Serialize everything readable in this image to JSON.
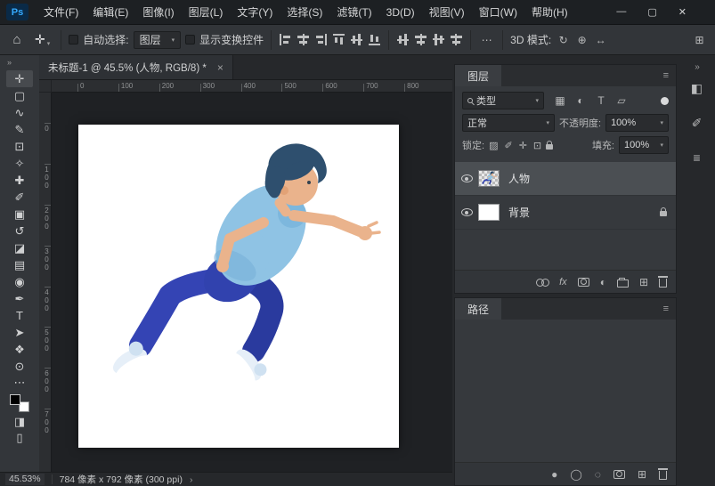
{
  "app": {
    "accent": "#31a8ff",
    "bg_dark": "#1d2023",
    "bg_panel": "#36393d"
  },
  "titlebar": {
    "logo": "Ps",
    "menus": [
      {
        "name": "menu-file",
        "label": "文件(F)"
      },
      {
        "name": "menu-edit",
        "label": "编辑(E)"
      },
      {
        "name": "menu-image",
        "label": "图像(I)"
      },
      {
        "name": "menu-layer",
        "label": "图层(L)"
      },
      {
        "name": "menu-type",
        "label": "文字(Y)"
      },
      {
        "name": "menu-select",
        "label": "选择(S)"
      },
      {
        "name": "menu-filter",
        "label": "滤镜(T)"
      },
      {
        "name": "menu-3d",
        "label": "3D(D)"
      },
      {
        "name": "menu-view",
        "label": "视图(V)"
      },
      {
        "name": "menu-window",
        "label": "窗口(W)"
      },
      {
        "name": "menu-help",
        "label": "帮助(H)"
      }
    ],
    "controls": [
      {
        "name": "minimize-button",
        "glyph": "—"
      },
      {
        "name": "maximize-button",
        "glyph": "▢"
      },
      {
        "name": "close-button",
        "glyph": "✕"
      }
    ]
  },
  "options_bar": {
    "home_icon": "⌂",
    "tool_glyph": "✛",
    "tool_chevron": "▾",
    "auto_select_label": "自动选择:",
    "auto_select_value": "图层",
    "chevron": "▾",
    "show_transform_label": "显示变换控件",
    "more_icon": "⋯",
    "mode_label": "3D 模式:",
    "mode_icons": [
      {
        "name": "3d-rotate-icon",
        "glyph": "↻"
      },
      {
        "name": "3d-pan-icon",
        "glyph": "⊕"
      },
      {
        "name": "3d-scale-icon",
        "glyph": "↔"
      }
    ],
    "workspace_icon": "⊞"
  },
  "document": {
    "tab_title": "未标题-1 @ 45.5% (人物, RGB/8) *",
    "close_icon": "×"
  },
  "toolbar": {
    "expand_icon": "»",
    "tools": [
      {
        "name": "move-tool",
        "glyph": "✛",
        "selected": true
      },
      {
        "name": "rectangular-marquee-tool",
        "glyph": "▢"
      },
      {
        "name": "lasso-tool",
        "glyph": "∿"
      },
      {
        "name": "quick-selection-tool",
        "glyph": "✎"
      },
      {
        "name": "crop-tool",
        "glyph": "⊡"
      },
      {
        "name": "eyedropper-tool",
        "glyph": "✧"
      },
      {
        "name": "spot-healing-tool",
        "glyph": "✚"
      },
      {
        "name": "brush-tool",
        "glyph": "✐"
      },
      {
        "name": "clone-stamp-tool",
        "glyph": "▣"
      },
      {
        "name": "history-brush-tool",
        "glyph": "↺"
      },
      {
        "name": "eraser-tool",
        "glyph": "◪"
      },
      {
        "name": "gradient-tool",
        "glyph": "▤"
      },
      {
        "name": "blur-tool",
        "glyph": "◉"
      },
      {
        "name": "pen-tool",
        "glyph": "✒"
      },
      {
        "name": "type-tool",
        "glyph": "T"
      },
      {
        "name": "path-selection-tool",
        "glyph": "➤"
      },
      {
        "name": "hand-tool",
        "glyph": "❖"
      },
      {
        "name": "zoom-tool",
        "glyph": "⊙"
      }
    ],
    "more_icon": "⋯",
    "foreground_color": "#000000",
    "background_color": "#ffffff",
    "quick_mask_icon": "◨",
    "screen_mode_icon": "▯"
  },
  "rulers": {
    "horizontal": [
      "0",
      "100",
      "200",
      "300",
      "400",
      "500",
      "600",
      "700",
      "800"
    ],
    "vertical": [
      "0",
      "100",
      "200",
      "300",
      "400",
      "500",
      "600",
      "700"
    ]
  },
  "layers_panel": {
    "tab": "图层",
    "menu_icon": "≡",
    "filter": {
      "search_label": "类型",
      "chevron": "▾",
      "icons": [
        {
          "name": "filter-pixel-icon",
          "glyph": "▦"
        },
        {
          "name": "filter-adjustment-icon",
          "glyph": "◐"
        },
        {
          "name": "filter-type-icon",
          "glyph": "T"
        },
        {
          "name": "filter-shape-icon",
          "glyph": "▱"
        }
      ]
    },
    "blend_mode": "正常",
    "opacity_label": "不透明度:",
    "opacity_value": "100%",
    "lock_label": "锁定:",
    "lock_icons": [
      {
        "name": "lock-transparent-icon",
        "glyph": "▨"
      },
      {
        "name": "lock-paint-icon",
        "glyph": "✐"
      },
      {
        "name": "lock-move-icon",
        "glyph": "✛"
      },
      {
        "name": "lock-artboard-icon",
        "glyph": "⊡"
      }
    ],
    "fill_label": "填充:",
    "fill_value": "100%",
    "layers": [
      {
        "name": "人物",
        "visible": true,
        "selected": true
      },
      {
        "name": "背景",
        "visible": true,
        "locked": true
      }
    ],
    "footer": {
      "fx_label": "fx",
      "adjust_icon": "◐",
      "new_icon": "⊞"
    }
  },
  "paths_panel": {
    "tab": "路径",
    "footer": {
      "fill_icon": "●",
      "stroke_icon": "◯",
      "selection_icon": "◌",
      "new_icon": "⊞"
    }
  },
  "panel_strip": {
    "collapse_icon": "»",
    "icons": [
      {
        "name": "libraries-panel-icon",
        "glyph": "◧"
      },
      {
        "name": "brush-settings-panel-icon",
        "glyph": "✐"
      },
      {
        "name": "properties-panel-icon",
        "glyph": "≡"
      }
    ]
  },
  "status_bar": {
    "zoom": "45.53%",
    "doc_info": "784 像素 x 792 像素 (300 ppi)",
    "chevron": "›"
  },
  "canvas": {
    "artwork": "3d-running-person",
    "palette": {
      "hair": "#2e4f6e",
      "skin": "#eab38c",
      "shirt": "#8fc3e4",
      "pants": "#3344b2",
      "pants_dark": "#2a3a9e",
      "shoes": "#e6eff8"
    }
  }
}
